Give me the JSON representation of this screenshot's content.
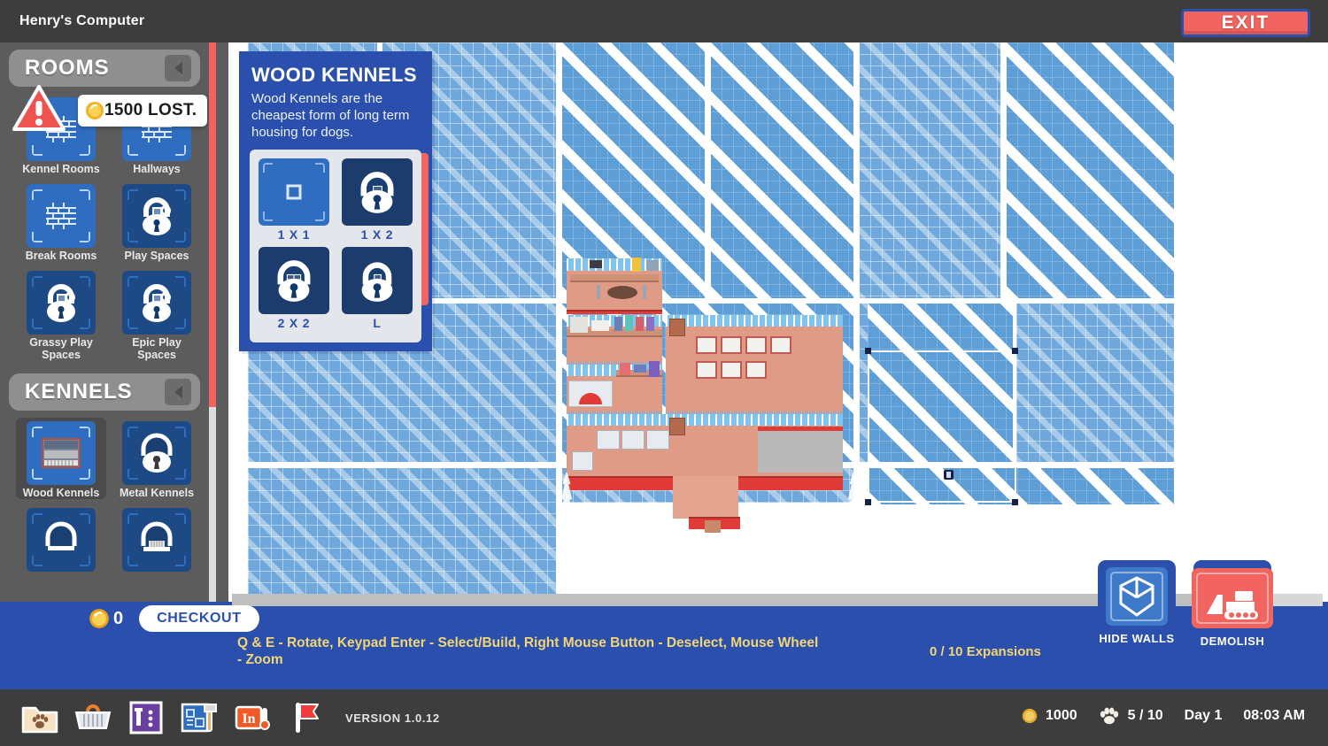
{
  "window": {
    "title": "Henry's Computer",
    "exit_label": "EXIT"
  },
  "alert": {
    "icon": "warning-triangle-icon",
    "coin_icon": "coin-icon",
    "text": "1500 LOST."
  },
  "sidebar": {
    "sections": [
      {
        "title": "ROOMS",
        "collapse_icon": "chevron-left-icon",
        "items": [
          {
            "label": "Kennel Rooms",
            "locked": false,
            "glyph": "brick-wall-icon",
            "selected": false
          },
          {
            "label": "Hallways",
            "locked": false,
            "glyph": "brick-wall-icon",
            "selected": false
          },
          {
            "label": "Break Rooms",
            "locked": false,
            "glyph": "brick-wall-icon",
            "selected": false
          },
          {
            "label": "Play Spaces",
            "locked": true,
            "glyph": "padlock-icon",
            "selected": false
          },
          {
            "label": "Grassy Play Spaces",
            "locked": true,
            "glyph": "padlock-icon",
            "selected": false
          },
          {
            "label": "Epic Play Spaces",
            "locked": true,
            "glyph": "padlock-icon",
            "selected": false
          }
        ]
      },
      {
        "title": "KENNELS",
        "collapse_icon": "chevron-left-icon",
        "items": [
          {
            "label": "Wood Kennels",
            "locked": false,
            "glyph": "wood-kennel-icon",
            "selected": true
          },
          {
            "label": "Metal Kennels",
            "locked": true,
            "glyph": "padlock-icon",
            "selected": false
          },
          {
            "label": "",
            "locked": true,
            "glyph": "padlock-icon",
            "selected": false
          },
          {
            "label": "",
            "locked": true,
            "glyph": "padlock-icon",
            "selected": false
          }
        ]
      }
    ]
  },
  "tooltip": {
    "title": "WOOD KENNELS",
    "description": "Wood Kennels are the cheapest form of long term housing for dogs.",
    "sizes": [
      {
        "label": "1 X 1",
        "locked": false
      },
      {
        "label": "1 X 2",
        "locked": true
      },
      {
        "label": "2 X 2",
        "locked": true
      },
      {
        "label": "L",
        "locked": true
      }
    ]
  },
  "cart": {
    "coin_icon": "coin-icon",
    "amount": "0",
    "checkout_label": "CHECKOUT"
  },
  "hints": {
    "text": "Q & E  - Rotate,  Keypad Enter  - Select/Build,  Right Mouse Button  - Deselect, Mouse Wheel - Zoom"
  },
  "expansions": {
    "text": "0 / 10  Expansions"
  },
  "map_tools": [
    {
      "label": "HIDE WALLS",
      "icon": "cube-icon"
    },
    {
      "label": "DEMOLISH",
      "icon": "bulldozer-icon"
    }
  ],
  "taskbar": {
    "icons": [
      {
        "name": "dog-folder-icon"
      },
      {
        "name": "shopping-basket-icon"
      },
      {
        "name": "stats-chart-icon"
      },
      {
        "name": "blueprint-hammer-icon"
      },
      {
        "name": "inventory-icon"
      },
      {
        "name": "red-flag-icon"
      }
    ],
    "version": "VERSION 1.0.12"
  },
  "status": {
    "coin_icon": "coin-icon",
    "money": "1000",
    "paw_icon": "paw-icon",
    "dogs": "5 / 10",
    "day": "Day 1",
    "time": "08:03 AM"
  },
  "colors": {
    "accent_blue": "#2a4fad",
    "accent_red": "#f2645f",
    "panel_gray": "#5c5c5c",
    "chrome_gray": "#3d3d3d",
    "tile_blue": "#6fa8dd",
    "hint_yellow": "#f2d574"
  }
}
